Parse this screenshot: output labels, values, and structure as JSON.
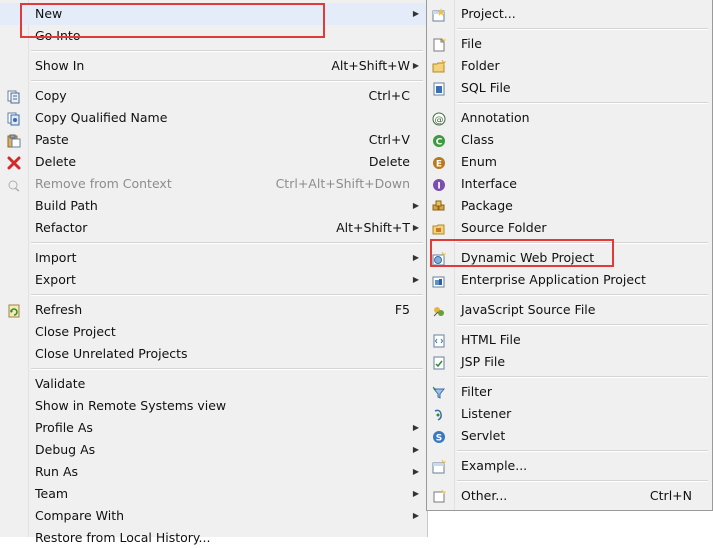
{
  "main_menu": {
    "items": [
      {
        "label": "New",
        "shortcut": "",
        "arrow": true,
        "icon": "",
        "highlighted": true
      },
      {
        "label": "Go Into",
        "shortcut": "",
        "arrow": false,
        "icon": ""
      },
      {
        "label": "Show In",
        "shortcut": "Alt+Shift+W",
        "arrow": true,
        "icon": ""
      },
      {
        "label": "Copy",
        "shortcut": "Ctrl+C",
        "arrow": false,
        "icon": "copy-icon"
      },
      {
        "label": "Copy Qualified Name",
        "shortcut": "",
        "arrow": false,
        "icon": "copy-qualified-name-icon"
      },
      {
        "label": "Paste",
        "shortcut": "Ctrl+V",
        "arrow": false,
        "icon": "paste-icon"
      },
      {
        "label": "Delete",
        "shortcut": "Delete",
        "arrow": false,
        "icon": "delete-icon"
      },
      {
        "label": "Remove from Context",
        "shortcut": "Ctrl+Alt+Shift+Down",
        "arrow": false,
        "icon": "remove-from-context-icon",
        "disabled": true
      },
      {
        "label": "Build Path",
        "shortcut": "",
        "arrow": true,
        "icon": ""
      },
      {
        "label": "Refactor",
        "shortcut": "Alt+Shift+T",
        "arrow": true,
        "icon": ""
      },
      {
        "label": "Import",
        "shortcut": "",
        "arrow": true,
        "icon": ""
      },
      {
        "label": "Export",
        "shortcut": "",
        "arrow": true,
        "icon": ""
      },
      {
        "label": "Refresh",
        "shortcut": "F5",
        "arrow": false,
        "icon": "refresh-icon"
      },
      {
        "label": "Close Project",
        "shortcut": "",
        "arrow": false,
        "icon": ""
      },
      {
        "label": "Close Unrelated Projects",
        "shortcut": "",
        "arrow": false,
        "icon": ""
      },
      {
        "label": "Validate",
        "shortcut": "",
        "arrow": false,
        "icon": ""
      },
      {
        "label": "Show in Remote Systems view",
        "shortcut": "",
        "arrow": false,
        "icon": ""
      },
      {
        "label": "Profile As",
        "shortcut": "",
        "arrow": true,
        "icon": ""
      },
      {
        "label": "Debug As",
        "shortcut": "",
        "arrow": true,
        "icon": ""
      },
      {
        "label": "Run As",
        "shortcut": "",
        "arrow": true,
        "icon": ""
      },
      {
        "label": "Team",
        "shortcut": "",
        "arrow": true,
        "icon": ""
      },
      {
        "label": "Compare With",
        "shortcut": "",
        "arrow": true,
        "icon": ""
      },
      {
        "label": "Restore from Local History...",
        "shortcut": "",
        "arrow": false,
        "icon": ""
      }
    ]
  },
  "sub_menu": {
    "items": [
      {
        "label": "Project...",
        "shortcut": "",
        "icon": "project-icon"
      },
      {
        "label": "File",
        "shortcut": "",
        "icon": "file-icon"
      },
      {
        "label": "Folder",
        "shortcut": "",
        "icon": "folder-icon"
      },
      {
        "label": "SQL File",
        "shortcut": "",
        "icon": "sql-file-icon"
      },
      {
        "label": "Annotation",
        "shortcut": "",
        "icon": "annotation-icon"
      },
      {
        "label": "Class",
        "shortcut": "",
        "icon": "class-icon"
      },
      {
        "label": "Enum",
        "shortcut": "",
        "icon": "enum-icon"
      },
      {
        "label": "Interface",
        "shortcut": "",
        "icon": "interface-icon"
      },
      {
        "label": "Package",
        "shortcut": "",
        "icon": "package-icon"
      },
      {
        "label": "Source Folder",
        "shortcut": "",
        "icon": "source-folder-icon"
      },
      {
        "label": "Dynamic Web Project",
        "shortcut": "",
        "icon": "dynamic-web-project-icon"
      },
      {
        "label": "Enterprise Application Project",
        "shortcut": "",
        "icon": "enterprise-application-project-icon"
      },
      {
        "label": "JavaScript Source File",
        "shortcut": "",
        "icon": "javascript-source-file-icon"
      },
      {
        "label": "HTML File",
        "shortcut": "",
        "icon": "html-file-icon"
      },
      {
        "label": "JSP File",
        "shortcut": "",
        "icon": "jsp-file-icon"
      },
      {
        "label": "Filter",
        "shortcut": "",
        "icon": "filter-icon"
      },
      {
        "label": "Listener",
        "shortcut": "",
        "icon": "listener-icon"
      },
      {
        "label": "Servlet",
        "shortcut": "",
        "icon": "servlet-icon"
      },
      {
        "label": "Example...",
        "shortcut": "",
        "icon": "example-icon"
      },
      {
        "label": "Other...",
        "shortcut": "Ctrl+N",
        "icon": "other-icon"
      }
    ]
  },
  "colors": {
    "highlight_box": "#e03a3a",
    "menu_bg": "#f0f0f0",
    "hover_bg": "#e3ecf8"
  }
}
